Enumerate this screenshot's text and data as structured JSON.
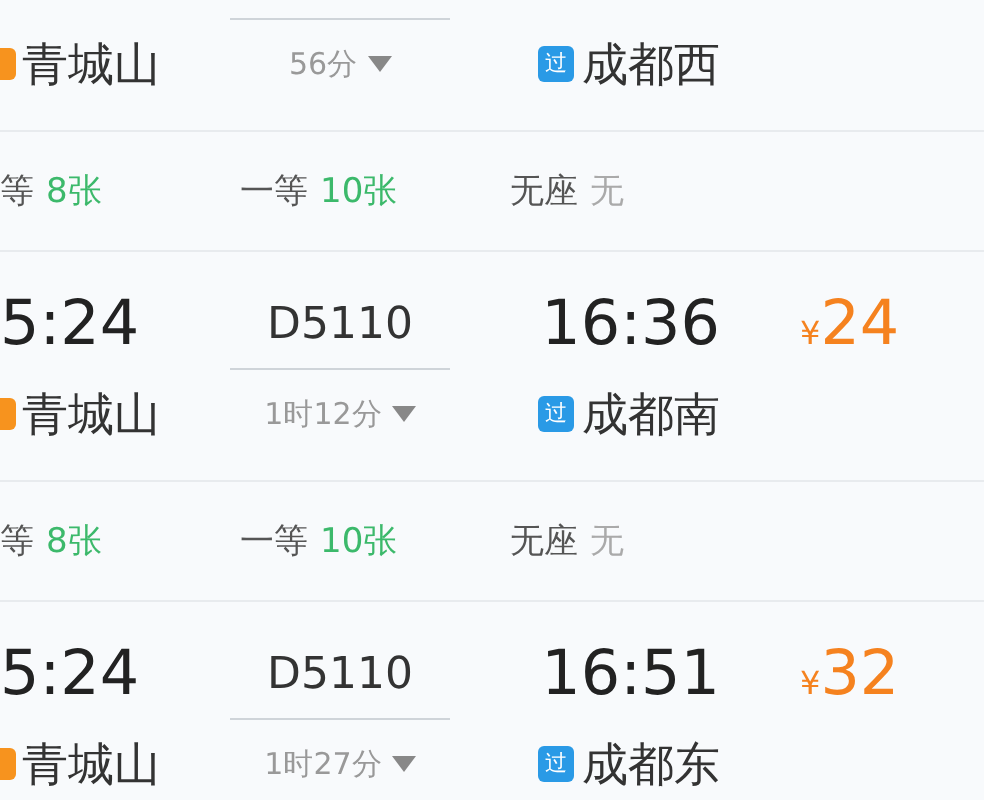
{
  "trains": [
    {
      "from_station": "青城山",
      "duration": "56分",
      "to_badge": "过",
      "to_station": "成都西",
      "seats": [
        {
          "class": "等",
          "count": "8张",
          "available": true
        },
        {
          "class": "一等",
          "count": "10张",
          "available": true
        },
        {
          "class": "无座",
          "count": "无",
          "available": false
        }
      ]
    },
    {
      "depart_time": "5:24",
      "train_no": "D5110",
      "arrive_time": "16:36",
      "price_symbol": "¥",
      "price": "24",
      "from_station": "青城山",
      "duration": "1时12分",
      "to_badge": "过",
      "to_station": "成都南",
      "seats": [
        {
          "class": "等",
          "count": "8张",
          "available": true
        },
        {
          "class": "一等",
          "count": "10张",
          "available": true
        },
        {
          "class": "无座",
          "count": "无",
          "available": false
        }
      ]
    },
    {
      "depart_time": "5:24",
      "train_no": "D5110",
      "arrive_time": "16:51",
      "price_symbol": "¥",
      "price": "32",
      "from_station": "青城山",
      "duration": "1时27分",
      "to_badge": "过",
      "to_station": "成都东"
    }
  ]
}
